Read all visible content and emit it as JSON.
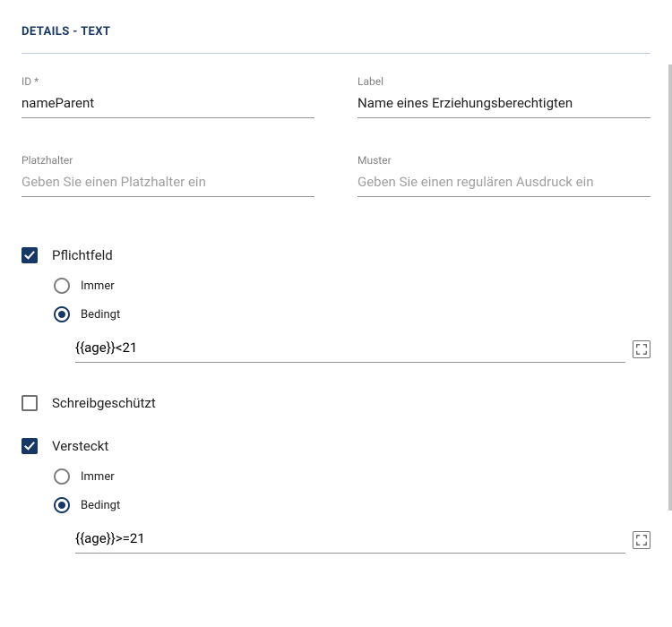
{
  "section": {
    "title": "DETAILS - TEXT"
  },
  "fields": {
    "id": {
      "label": "ID *",
      "value": "nameParent"
    },
    "label": {
      "label": "Label",
      "value": "Name eines Erziehungsberechtigten"
    },
    "placeholder": {
      "label": "Platzhalter",
      "placeholder": "Geben Sie einen Platzhalter ein",
      "value": ""
    },
    "pattern": {
      "label": "Muster",
      "placeholder": "Geben Sie einen regulären Ausdruck ein",
      "value": ""
    }
  },
  "required": {
    "label": "Pflichtfeld",
    "checked": true,
    "options": {
      "always": "Immer",
      "conditional": "Bedingt"
    },
    "mode": "conditional",
    "expression": "{{age}}<21"
  },
  "readonly": {
    "label": "Schreibgeschützt",
    "checked": false
  },
  "hidden": {
    "label": "Versteckt",
    "checked": true,
    "options": {
      "always": "Immer",
      "conditional": "Bedingt"
    },
    "mode": "conditional",
    "expression": "{{age}}>=21"
  }
}
